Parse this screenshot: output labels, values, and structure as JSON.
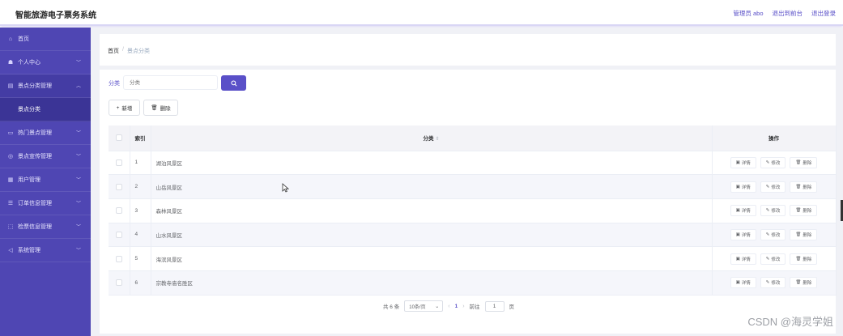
{
  "header": {
    "title": "智能旅游电子票务系统",
    "admin": "管理员 abo",
    "backend": "退出到前台",
    "logout": "退出登录"
  },
  "sidebar": {
    "items": [
      {
        "label": "首页",
        "icon": "home-icon"
      },
      {
        "label": "个人中心",
        "icon": "user-icon"
      },
      {
        "label": "景点分类管理",
        "icon": "category-icon"
      },
      {
        "label": "景点分类",
        "icon": ""
      },
      {
        "label": "热门景点管理",
        "icon": "hot-icon"
      },
      {
        "label": "景点宣传管理",
        "icon": "promo-icon"
      },
      {
        "label": "用户管理",
        "icon": "users-icon"
      },
      {
        "label": "订单信息管理",
        "icon": "order-icon"
      },
      {
        "label": "检票信息管理",
        "icon": "ticket-icon"
      },
      {
        "label": "系统管理",
        "icon": "system-icon"
      }
    ]
  },
  "breadcrumb": {
    "home": "首页",
    "sep": "/",
    "current": "景点分类"
  },
  "search": {
    "label": "分类",
    "placeholder": "分类",
    "button_icon": "search-icon"
  },
  "toolbar": {
    "add_label": "新增",
    "delete_label": "删除"
  },
  "table": {
    "headers": {
      "index": "索引",
      "name": "分类",
      "actions": "操作"
    },
    "rows": [
      {
        "index": "1",
        "name": "湖泊风景区"
      },
      {
        "index": "2",
        "name": "山岳风景区"
      },
      {
        "index": "3",
        "name": "森林风景区"
      },
      {
        "index": "4",
        "name": "山水风景区"
      },
      {
        "index": "5",
        "name": "海滨风景区"
      },
      {
        "index": "6",
        "name": "宗教寺庙名胜区"
      }
    ],
    "actions": {
      "detail": "详情",
      "edit": "修改",
      "delete": "删除"
    }
  },
  "pagination": {
    "total": "共 6 条",
    "page_size": "10条/页",
    "current": "1",
    "goto_prefix": "前往",
    "goto_value": "1",
    "goto_suffix": "页"
  },
  "watermark": "CSDN @海灵学姐",
  "colors": {
    "primary": "#5a50c8",
    "sidebar": "#4f46b3"
  }
}
